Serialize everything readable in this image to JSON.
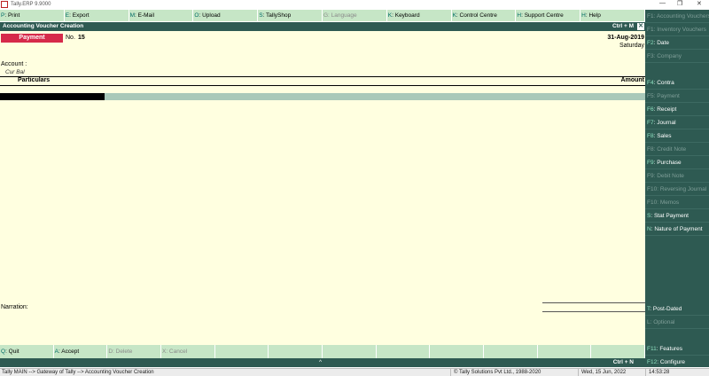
{
  "window": {
    "title": "Tally.ERP 9.9000",
    "minimize_glyph": "—",
    "restore_glyph": "❐",
    "close_glyph": "✕"
  },
  "top_menu": [
    {
      "key": "P",
      "label": ": Print",
      "enabled": true
    },
    {
      "key": "E",
      "label": ": Export",
      "enabled": true
    },
    {
      "key": "M",
      "label": ": E-Mail",
      "enabled": true
    },
    {
      "key": "O",
      "label": ": Upload",
      "enabled": true
    },
    {
      "key": "S",
      "label": ": TallyShop",
      "enabled": true
    },
    {
      "key": "G",
      "label": ": Language",
      "enabled": false
    },
    {
      "key": "K",
      "label": ": Keyboard",
      "enabled": true
    },
    {
      "key": "K",
      "label": ": Control Centre",
      "enabled": true
    },
    {
      "key": "H",
      "label": ": Support Centre",
      "enabled": true
    },
    {
      "key": "H",
      "label": ": Help",
      "enabled": true
    }
  ],
  "header": {
    "title": "Accounting Voucher  Creation",
    "shortcut": "Ctrl + M",
    "close_glyph": "✕"
  },
  "voucher": {
    "type": "Payment",
    "number_label": "No.",
    "number": "15",
    "date": "31-Aug-2019",
    "day": "Saturday",
    "account_label": "Account :",
    "cur_bal_label": "Cur Bal",
    "col_particulars": "Particulars",
    "col_amount": "Amount",
    "narration_label": "Narration:"
  },
  "bottom_buttons": [
    {
      "key": "Q",
      "label": ": Quit",
      "enabled": true
    },
    {
      "key": "A",
      "label": ": Accept",
      "enabled": true
    },
    {
      "key": "D",
      "label": ": Delete",
      "enabled": false
    },
    {
      "key": "X",
      "label": ": Cancel",
      "enabled": false
    },
    {
      "key": "",
      "label": "",
      "enabled": false
    },
    {
      "key": "",
      "label": "",
      "enabled": false
    },
    {
      "key": "",
      "label": "",
      "enabled": false
    },
    {
      "key": "",
      "label": "",
      "enabled": false
    },
    {
      "key": "",
      "label": "",
      "enabled": false
    },
    {
      "key": "",
      "label": "",
      "enabled": false
    },
    {
      "key": "",
      "label": "",
      "enabled": false
    },
    {
      "key": "",
      "label": "",
      "enabled": false
    }
  ],
  "bottom_strip": {
    "caret": "^",
    "shortcut": "Ctrl + N"
  },
  "sidebar": [
    {
      "key": "F1",
      "label": ": Accounting Vouchers",
      "enabled": false,
      "slot": 0
    },
    {
      "key": "F1",
      "label": ": Inventory Vouchers",
      "enabled": false,
      "slot": 1
    },
    {
      "key": "F2",
      "label": ": Date",
      "enabled": true,
      "slot": 2
    },
    {
      "key": "F3",
      "label": ": Company",
      "enabled": false,
      "slot": 3
    },
    {
      "key": "F4",
      "label": ": Contra",
      "enabled": true,
      "slot": 5
    },
    {
      "key": "F5",
      "label": ": Payment",
      "enabled": false,
      "slot": 6
    },
    {
      "key": "F6",
      "label": ": Receipt",
      "enabled": true,
      "slot": 7
    },
    {
      "key": "F7",
      "label": ": Journal",
      "enabled": true,
      "slot": 8
    },
    {
      "key": "F8",
      "label": ": Sales",
      "enabled": true,
      "slot": 9
    },
    {
      "key": "F8",
      "label": ": Credit Note",
      "enabled": false,
      "slot": 10
    },
    {
      "key": "F9",
      "label": ": Purchase",
      "enabled": true,
      "slot": 11
    },
    {
      "key": "F9",
      "label": ": Debit Note",
      "enabled": false,
      "slot": 12
    },
    {
      "key": "F10",
      "label": ": Reversing Journal",
      "enabled": false,
      "slot": 13
    },
    {
      "key": "F10",
      "label": ": Memos",
      "enabled": false,
      "slot": 14
    },
    {
      "key": "S",
      "label": ": Stat Payment",
      "enabled": true,
      "slot": 15
    },
    {
      "key": "N",
      "label": ": Nature of Payment",
      "enabled": true,
      "slot": 16
    },
    {
      "key": "T",
      "label": ": Post-Dated",
      "enabled": true,
      "slot": 22
    },
    {
      "key": "L",
      "label": ": Optional",
      "enabled": false,
      "slot": 23
    },
    {
      "key": "F11",
      "label": ": Features",
      "enabled": true,
      "slot": 25
    },
    {
      "key": "F12",
      "label": ": Configure",
      "enabled": true,
      "slot": 26
    }
  ],
  "status_bar": {
    "path": "Tally MAIN --> Gateway of Tally --> Accounting Voucher  Creation",
    "copyright": "© Tally Solutions Pvt Ltd., 1988-2020",
    "date": "Wed, 15 Jun, 2022",
    "time": "14:53:28"
  },
  "colors": {
    "menu_bg": "#c6e6c6",
    "header_bg": "#2e5a52",
    "voucher_bg": "#ffffe0",
    "voucher_type_bg": "#d62a4a",
    "key_color": "#006b66"
  }
}
